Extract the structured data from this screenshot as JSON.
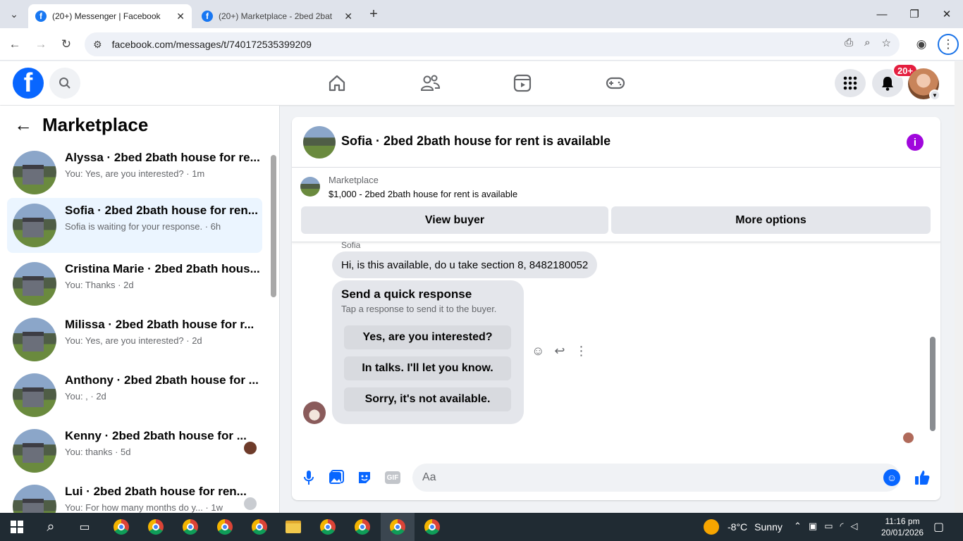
{
  "browser": {
    "tabs": [
      {
        "title": "(20+) Messenger | Facebook",
        "active": true
      },
      {
        "title": "(20+) Marketplace - 2bed 2bat",
        "active": false
      }
    ],
    "url": "facebook.com/messages/t/740172535399209"
  },
  "fbnav": {
    "notification_badge": "20+"
  },
  "sidebar": {
    "title": "Marketplace",
    "conversations": [
      {
        "name": "Alyssa · 2bed 2bath house for re...",
        "snippet": "You: Yes, are you interested? · 1m",
        "active": false
      },
      {
        "name": "Sofia · 2bed 2bath house for ren...",
        "snippet": "Sofia is waiting for your response. · 6h",
        "active": true
      },
      {
        "name": "Cristina Marie · 2bed 2bath hous...",
        "snippet": "You: Thanks · 2d",
        "active": false
      },
      {
        "name": "Milissa · 2bed 2bath house for r...",
        "snippet": "You: Yes, are you interested? · 2d",
        "active": false
      },
      {
        "name": "Anthony · 2bed 2bath house for ...",
        "snippet": "You: , · 2d",
        "active": false
      },
      {
        "name": "Kenny · 2bed 2bath house for ...",
        "snippet": "You: thanks · 5d",
        "active": false
      },
      {
        "name": "Lui · 2bed 2bath house for ren...",
        "snippet": "You: For how many months do y... · 1w",
        "active": false
      }
    ]
  },
  "chat": {
    "title": "Sofia · 2bed 2bath house for rent is available",
    "listing_label": "Marketplace",
    "listing_price_title": "$1,000 - 2bed 2bath house for rent is available",
    "view_buyer": "View buyer",
    "more_options": "More options",
    "sender": "Sofia",
    "message": "Hi, is this available, do u take section 8, 8482180052",
    "quick_response": {
      "heading": "Send a quick response",
      "subtext": "Tap a response to send it to the buyer.",
      "options": [
        "Yes, are you interested?",
        "In talks. I'll let you know.",
        "Sorry, it's not available."
      ]
    },
    "composer_placeholder": "Aa"
  },
  "taskbar": {
    "weather_temp": "-8°C",
    "weather_text": "Sunny",
    "time": "11:16 pm",
    "date": "20/01/2026"
  },
  "colors": {
    "fb_blue": "#0866ff",
    "active_conv": "#ebf5ff",
    "badge_red": "#e41e3f",
    "info_purple": "#a007dc"
  }
}
